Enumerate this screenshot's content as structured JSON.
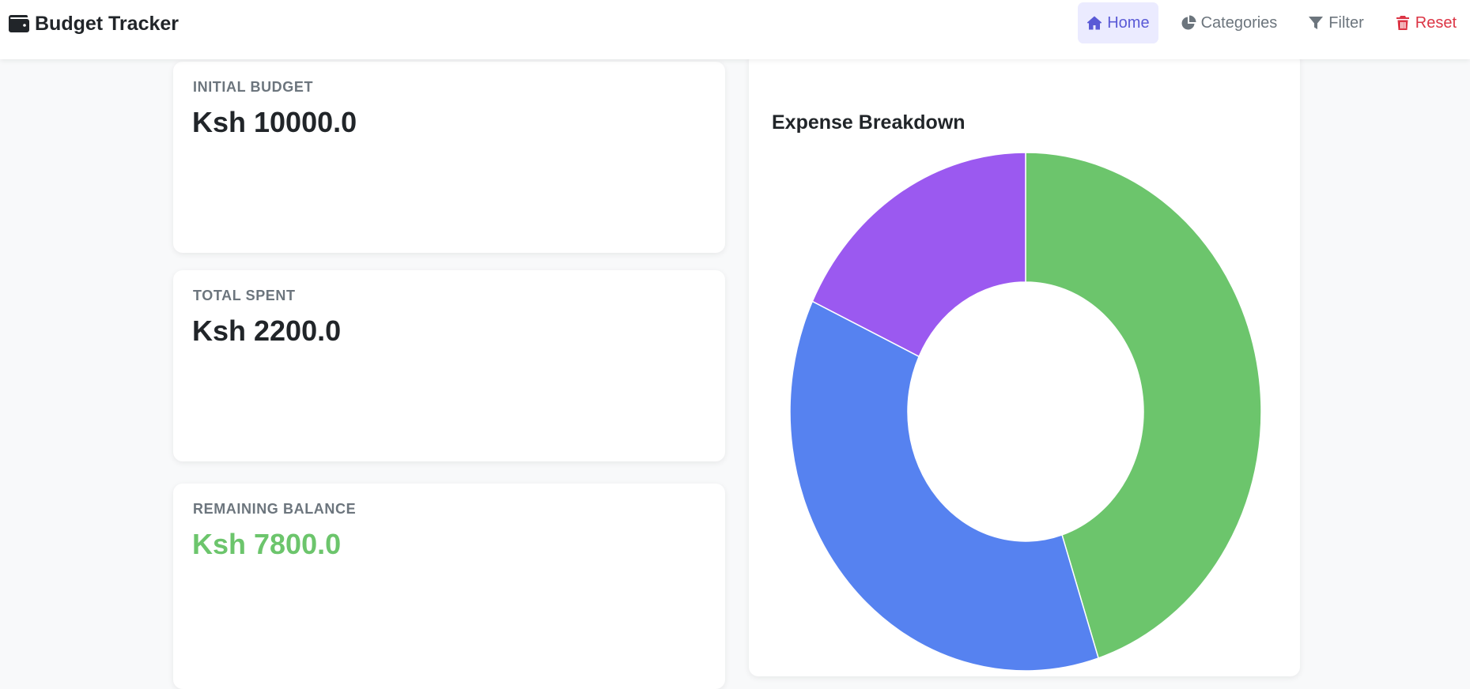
{
  "app": {
    "title": "Budget Tracker",
    "brand_icon": "wallet-icon"
  },
  "nav": {
    "items": [
      {
        "label": "Home",
        "icon": "home-icon",
        "active": true
      },
      {
        "label": "Categories",
        "icon": "pie-chart-icon",
        "active": false
      },
      {
        "label": "Filter",
        "icon": "filter-icon",
        "active": false
      },
      {
        "label": "Reset",
        "icon": "trash-icon",
        "active": false,
        "color": "#dc3545"
      }
    ]
  },
  "stats": [
    {
      "label": "INITIAL BUDGET",
      "value": "Ksh 10000.0"
    },
    {
      "label": "TOTAL SPENT",
      "value": "Ksh 2200.0"
    },
    {
      "label": "REMAINING BALANCE",
      "value": "Ksh 7800.0",
      "color": "#6cc56c"
    }
  ],
  "chart": {
    "title": "Expense Breakdown"
  },
  "chart_data": {
    "type": "pie",
    "variant": "doughnut",
    "title": "Expense Breakdown",
    "values": [
      0.45,
      0.37,
      0.18
    ],
    "colors": [
      "#6cc56c",
      "#5682f0",
      "#9b59f0"
    ],
    "legend": "none"
  }
}
